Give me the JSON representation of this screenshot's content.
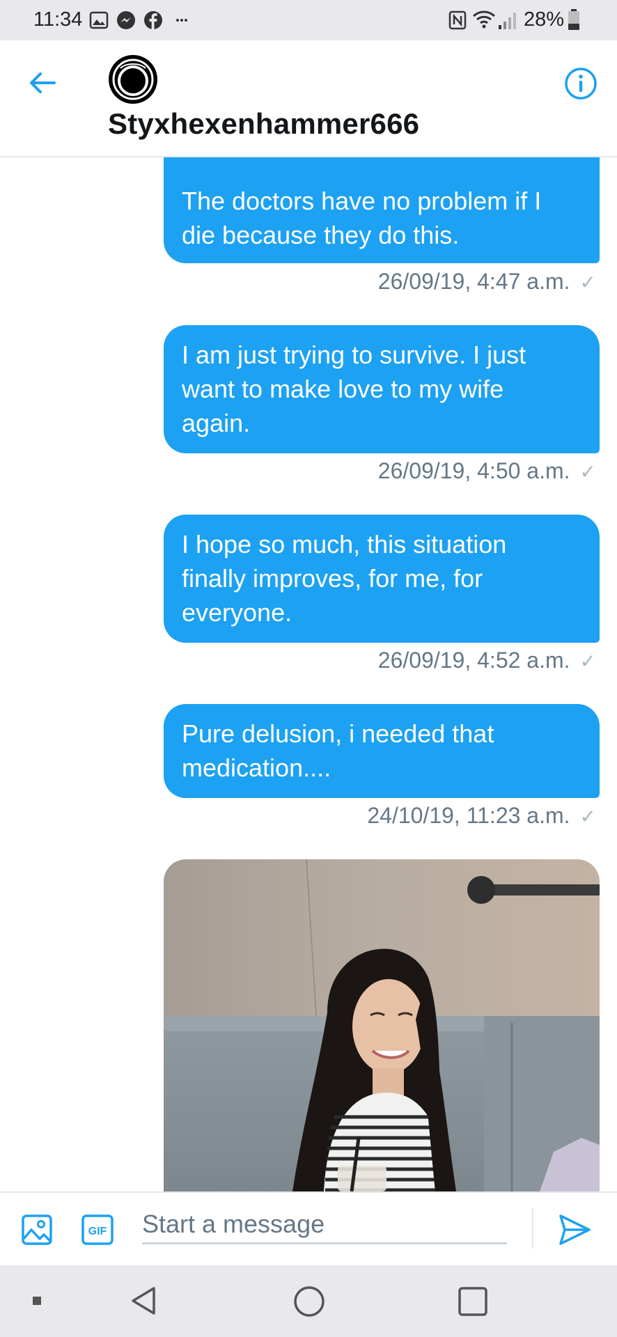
{
  "status_bar": {
    "time": "11:34",
    "battery_text": "28%",
    "icons": [
      "gallery-icon",
      "messenger-icon",
      "facebook-icon",
      "more-icon",
      "nfc-icon",
      "wifi-icon",
      "signal-icon",
      "battery-icon"
    ]
  },
  "header": {
    "handle": "Styxhexenhammer666",
    "icons": [
      "back-arrow-icon",
      "avatar",
      "info-icon"
    ]
  },
  "messages": [
    {
      "text": "The doctors have no problem if I die because they do this.",
      "lines": [
        "The doctors have no problem if I",
        "die because they do this."
      ],
      "timestamp": "26/09/19, 4:47 a.m."
    },
    {
      "text": "I am just trying to survive. I just want to make love to my wife again.",
      "lines": [
        "I am just trying to survive. I just",
        "want to make love to my wife",
        "again."
      ],
      "timestamp": "26/09/19, 4:50 a.m."
    },
    {
      "text": "I hope so much, this situation finally improves, for me, for everyone.",
      "lines": [
        "I hope so much, this situation",
        "finally improves, for me, for",
        "everyone."
      ],
      "timestamp": "26/09/19, 4:52 a.m."
    },
    {
      "text": "Pure delusion, i needed that medication....",
      "lines": [
        "Pure delusion, i needed that",
        "medication...."
      ],
      "timestamp": "24/10/19, 11:23 a.m."
    }
  ],
  "read_mark": "✓",
  "composer": {
    "placeholder": "Start a message",
    "gif_label": "GIF"
  },
  "colors": {
    "accent": "#1da1f2",
    "bubble_text": "#ffffff",
    "timestamp": "#657786",
    "system_bar": "#e9e9ed"
  }
}
